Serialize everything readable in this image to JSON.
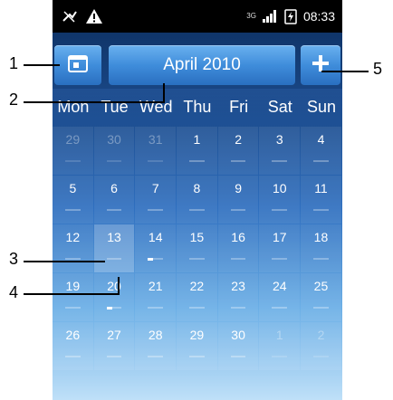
{
  "statusbar": {
    "time": "08:33",
    "network": "3G"
  },
  "header": {
    "month_label": "April 2010"
  },
  "weekdays": [
    "Mon",
    "Tue",
    "Wed",
    "Thu",
    "Fri",
    "Sat",
    "Sun"
  ],
  "weeks": [
    [
      "29",
      "30",
      "31",
      "1",
      "2",
      "3",
      "4"
    ],
    [
      "5",
      "6",
      "7",
      "8",
      "9",
      "10",
      "11"
    ],
    [
      "12",
      "13",
      "14",
      "15",
      "16",
      "17",
      "18"
    ],
    [
      "19",
      "20",
      "21",
      "22",
      "23",
      "24",
      "25"
    ],
    [
      "26",
      "27",
      "28",
      "29",
      "30",
      "1",
      "2"
    ]
  ],
  "callouts": {
    "c1": "1",
    "c2": "2",
    "c3": "3",
    "c4": "4",
    "c5": "5"
  },
  "colors": {
    "button": "#3f8ddb",
    "statusbar": "#000000",
    "text": "#ffffff"
  }
}
